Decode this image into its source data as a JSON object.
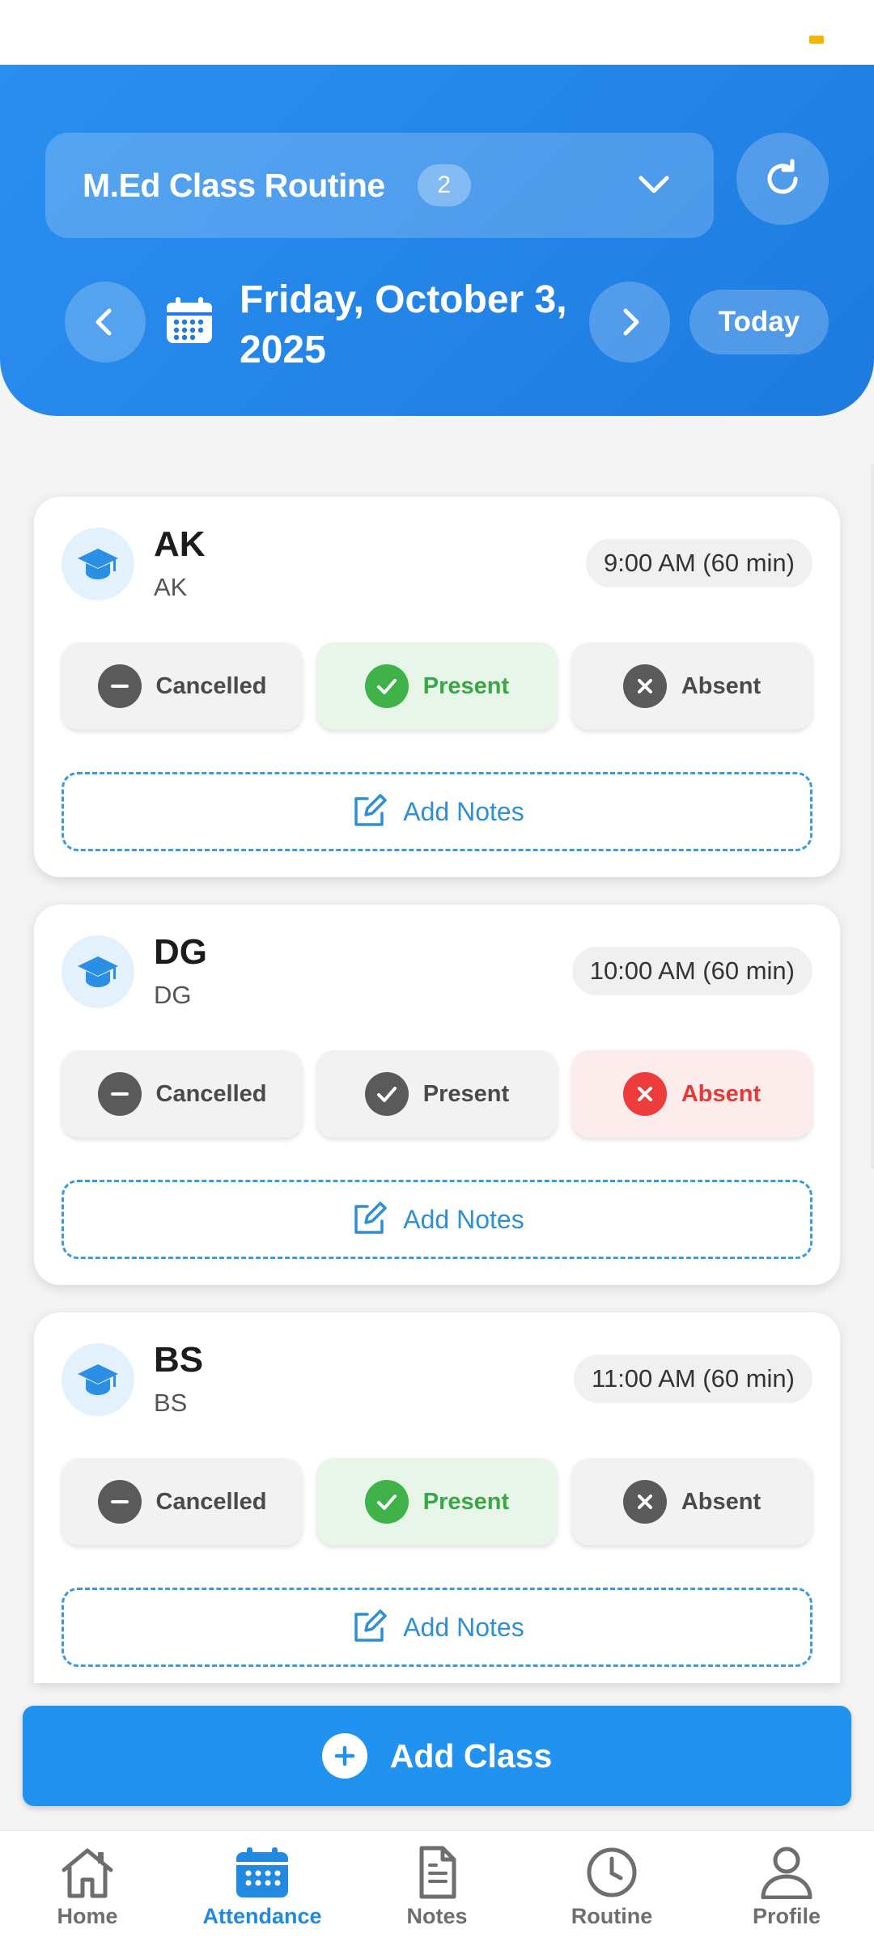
{
  "header": {
    "routine_title": "M.Ed Class Routine",
    "routine_count": "2",
    "date_line1": "Friday, October 3,",
    "date_line2": "2025",
    "today_label": "Today"
  },
  "status_labels": {
    "cancelled": "Cancelled",
    "present": "Present",
    "absent": "Absent"
  },
  "notes_label": "Add Notes",
  "classes": [
    {
      "code": "AK",
      "subtitle": "AK",
      "time": "9:00 AM (60 min)",
      "status": "present"
    },
    {
      "code": "DG",
      "subtitle": "DG",
      "time": "10:00 AM (60 min)",
      "status": "absent"
    },
    {
      "code": "BS",
      "subtitle": "BS",
      "time": "11:00 AM (60 min)",
      "status": "present"
    }
  ],
  "add_class_label": "Add Class",
  "nav": {
    "home": "Home",
    "attendance": "Attendance",
    "notes": "Notes",
    "routine": "Routine",
    "profile": "Profile",
    "active": "attendance"
  },
  "colors": {
    "primary": "#2192ef",
    "present": "#3fb24a",
    "absent": "#ee3b3b",
    "header_gradient_start": "#2a8ff0"
  }
}
